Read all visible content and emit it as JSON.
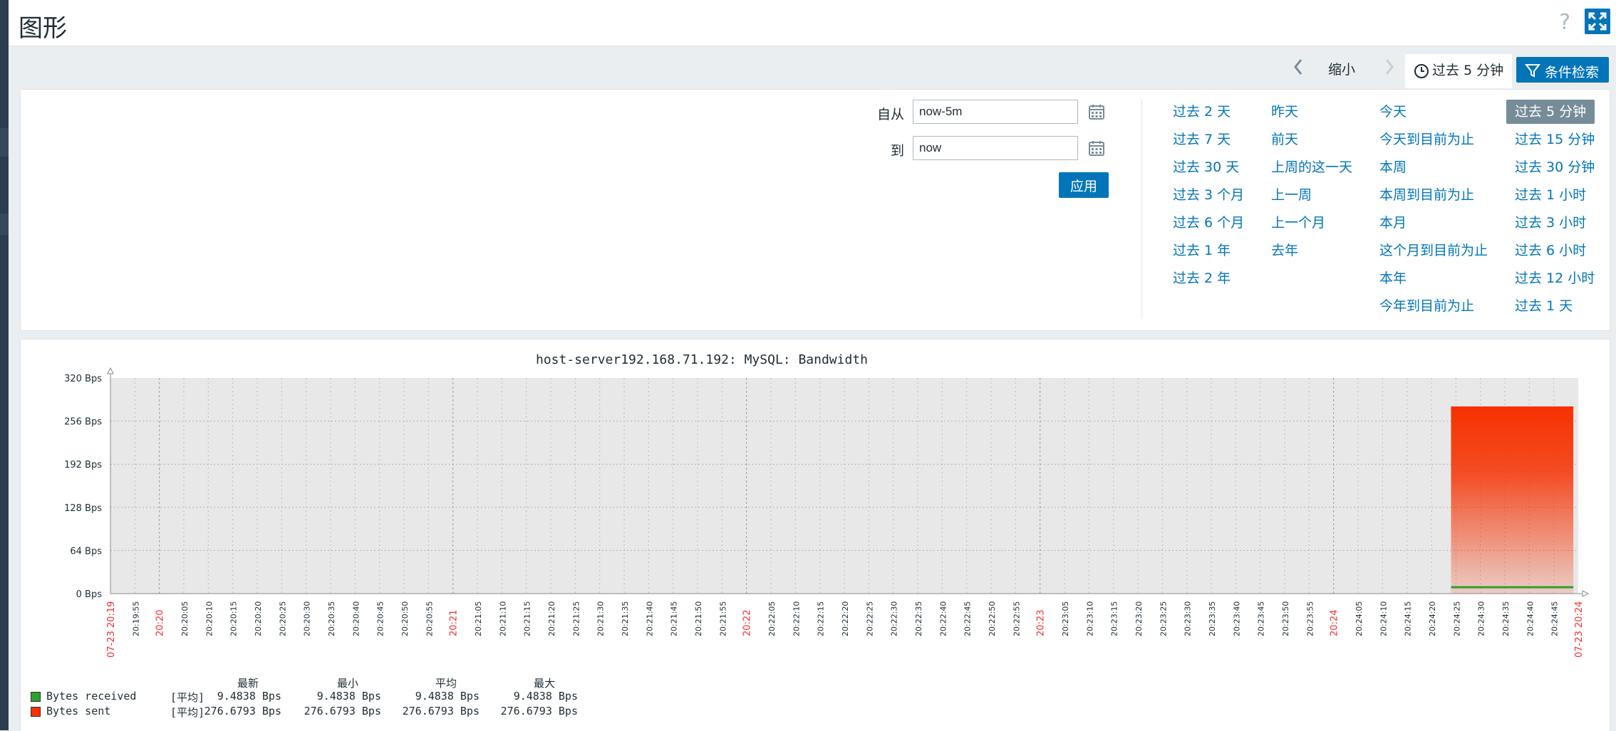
{
  "page": {
    "title": "图形",
    "help_glyph": "?"
  },
  "colors": {
    "accent": "#0275b8",
    "active_preset": "#768d99",
    "received": "#2ca12c",
    "sent": "#f63100",
    "time_marker": "#f22e2e"
  },
  "icons": [
    "question-mark-icon",
    "fullscreen-icon",
    "chevron-left-icon",
    "chevron-right-icon",
    "clock-icon",
    "funnel-icon",
    "calendar-icon"
  ],
  "toolbar": {
    "zoom_out": "缩小",
    "time_tab": "过去 5 分钟",
    "filter_tab": "条件检索"
  },
  "filter": {
    "from_label": "自从",
    "from_value": "now-5m",
    "to_label": "到",
    "to_value": "now",
    "apply": "应用",
    "quick_columns": [
      [
        "过去 2 天",
        "过去 7 天",
        "过去 30 天",
        "过去 3 个月",
        "过去 6 个月",
        "过去 1 年",
        "过去 2 年"
      ],
      [
        "昨天",
        "前天",
        "上周的这一天",
        "上一周",
        "上一个月",
        "去年"
      ],
      [
        "今天",
        "今天到目前为止",
        "本周",
        "本周到目前为止",
        "本月",
        "这个月到目前为止",
        "本年",
        "今年到目前为止"
      ],
      [
        "过去 5 分钟",
        "过去 15 分钟",
        "过去 30 分钟",
        "过去 1 小时",
        "过去 3 小时",
        "过去 6 小时",
        "过去 12 小时",
        "过去 1 天"
      ]
    ],
    "active_preset": "过去 5 分钟"
  },
  "chart_data": {
    "type": "area",
    "title": "host-server192.168.71.192: MySQL: Bandwidth",
    "y_ticks": [
      "320 Bps",
      "256 Bps",
      "192 Bps",
      "128 Bps",
      "64 Bps",
      "0 Bps"
    ],
    "ylim": [
      0,
      320
    ],
    "x_start_label": "07-23 20:19",
    "x_end_label": "07-23 20:24",
    "x_labels": [
      "20:19:55",
      "20:20",
      "20:20:05",
      "20:20:10",
      "20:20:15",
      "20:20:20",
      "20:20:25",
      "20:20:30",
      "20:20:35",
      "20:20:40",
      "20:20:45",
      "20:20:50",
      "20:20:55",
      "20:21",
      "20:21:05",
      "20:21:10",
      "20:21:15",
      "20:21:20",
      "20:21:25",
      "20:21:30",
      "20:21:35",
      "20:21:40",
      "20:21:45",
      "20:21:50",
      "20:21:55",
      "20:22",
      "20:22:05",
      "20:22:10",
      "20:22:15",
      "20:22:20",
      "20:22:25",
      "20:22:30",
      "20:22:35",
      "20:22:40",
      "20:22:45",
      "20:22:50",
      "20:22:55",
      "20:23",
      "20:23:05",
      "20:23:10",
      "20:23:15",
      "20:23:20",
      "20:23:25",
      "20:23:30",
      "20:23:35",
      "20:23:40",
      "20:23:45",
      "20:23:50",
      "20:23:55",
      "20:24",
      "20:24:05",
      "20:24:10",
      "20:24:15",
      "20:24:20",
      "20:24:25",
      "20:24:30",
      "20:24:35",
      "20:24:40",
      "20:24:45"
    ],
    "minute_marks": [
      "20:20",
      "20:21",
      "20:22",
      "20:23",
      "20:24"
    ],
    "series": [
      {
        "name": "Bytes received",
        "value": 9.4838,
        "from": "20:24:24",
        "to": "20:24:49"
      },
      {
        "name": "Bytes sent",
        "value": 276.6793,
        "from": "20:24:24",
        "to": "20:24:49"
      }
    ],
    "legend": {
      "headers": [
        "最新",
        "最小",
        "平均",
        "最大"
      ],
      "rows": [
        {
          "name": "Bytes received",
          "func": "[平均]",
          "last": "9.4838 Bps",
          "min": "9.4838 Bps",
          "avg": "9.4838 Bps",
          "max": "9.4838 Bps"
        },
        {
          "name": "Bytes sent",
          "func": "[平均]",
          "last": "276.6793 Bps",
          "min": "276.6793 Bps",
          "avg": "276.6793 Bps",
          "max": "276.6793 Bps"
        }
      ]
    }
  }
}
